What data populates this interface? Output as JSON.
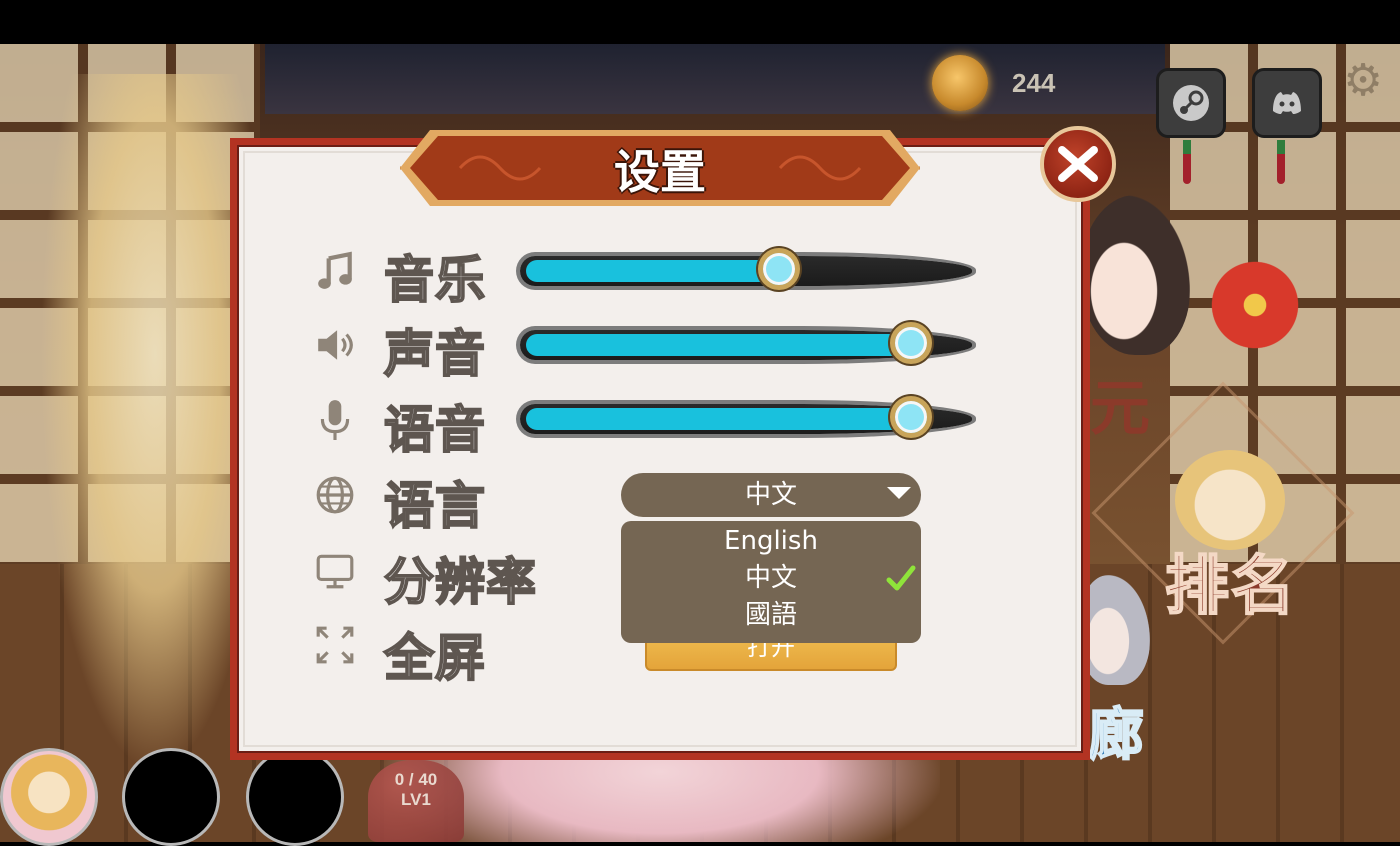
{
  "hud": {
    "coins": "244",
    "heart_counter": "0 / 40",
    "heart_level": "LV1",
    "right_menu_partial_1": "元",
    "right_menu_ranking": "排名",
    "right_menu_partial_2": "廊"
  },
  "settings": {
    "title": "设置",
    "music": {
      "label": "音乐",
      "icon": "music-note-icon",
      "value": 0.6
    },
    "sound": {
      "label": "声音",
      "icon": "speaker-icon",
      "value": 0.92
    },
    "voice": {
      "label": "语音",
      "icon": "microphone-icon",
      "value": 0.92
    },
    "language": {
      "label": "语言",
      "icon": "globe-icon",
      "selected": "中文",
      "options": [
        "English",
        "中文",
        "國語"
      ],
      "selected_index": 1
    },
    "resolution": {
      "label": "分辨率",
      "icon": "monitor-icon"
    },
    "fullscreen": {
      "label": "全屏",
      "icon": "fullscreen-icon",
      "button_label": "打开"
    }
  },
  "colors": {
    "slider_fill": "#19c1dd",
    "dialog_border": "#b33322",
    "dropdown_bg": "#756653",
    "check": "#8fe33a"
  }
}
